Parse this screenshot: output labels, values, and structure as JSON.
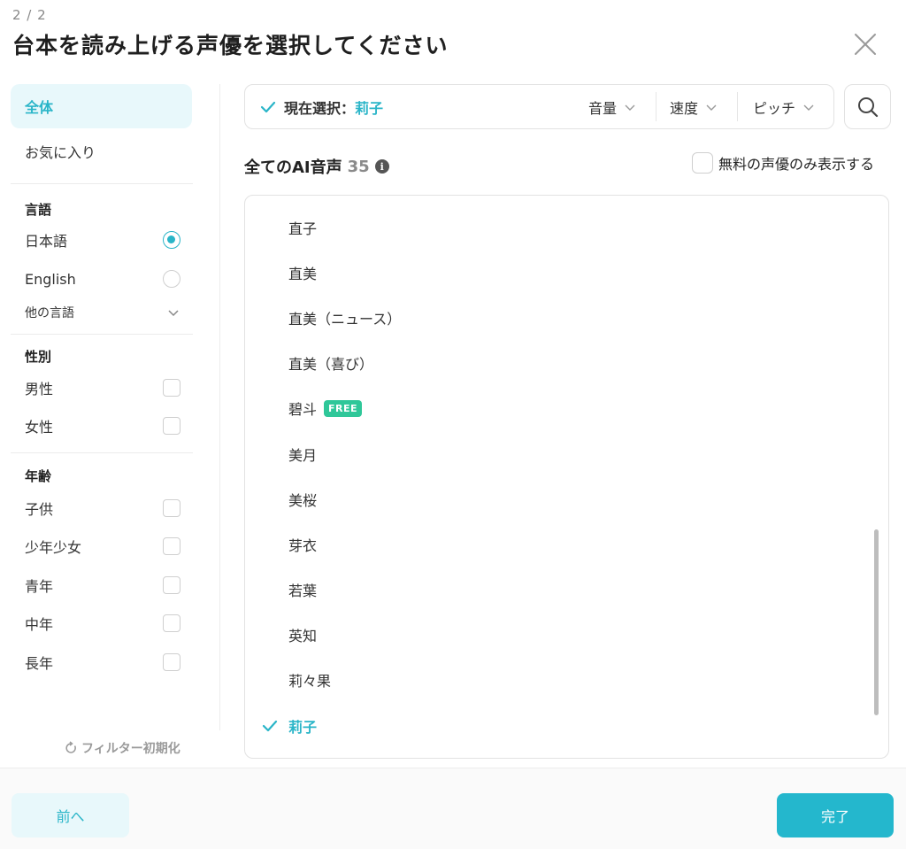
{
  "header": {
    "step": "2 / 2",
    "title": "台本を読み上げる声優を選択してください"
  },
  "sidebar": {
    "nav": [
      {
        "label": "全体",
        "active": true
      },
      {
        "label": "お気に入り",
        "active": false
      }
    ],
    "language": {
      "heading": "言語",
      "options": [
        {
          "label": "日本語",
          "selected": true
        },
        {
          "label": "English",
          "selected": false
        }
      ],
      "more_label": "他の言語"
    },
    "gender": {
      "heading": "性別",
      "options": [
        "男性",
        "女性"
      ]
    },
    "age": {
      "heading": "年齢",
      "options": [
        "子供",
        "少年少女",
        "青年",
        "中年",
        "長年"
      ]
    },
    "reset_label": "フィルター初期化"
  },
  "selection_bar": {
    "label": "現在選択：",
    "value": "莉子",
    "dropdowns": [
      "音量",
      "速度",
      "ピッチ"
    ]
  },
  "list": {
    "heading": "全てのAI音声",
    "count": "35",
    "free_filter_label": "無料の声優のみ表示する",
    "voices": [
      {
        "name": "直子",
        "free": false,
        "selected": false
      },
      {
        "name": "直美",
        "free": false,
        "selected": false
      },
      {
        "name": "直美（ニュース）",
        "free": false,
        "selected": false
      },
      {
        "name": "直美（喜び）",
        "free": false,
        "selected": false
      },
      {
        "name": "碧斗",
        "free": true,
        "selected": false
      },
      {
        "name": "美月",
        "free": false,
        "selected": false
      },
      {
        "name": "美桜",
        "free": false,
        "selected": false
      },
      {
        "name": "芽衣",
        "free": false,
        "selected": false
      },
      {
        "name": "若葉",
        "free": false,
        "selected": false
      },
      {
        "name": "英知",
        "free": false,
        "selected": false
      },
      {
        "name": "莉々果",
        "free": false,
        "selected": false
      },
      {
        "name": "莉子",
        "free": false,
        "selected": true
      }
    ],
    "free_badge": "FREE"
  },
  "footer": {
    "prev_label": "前へ",
    "done_label": "完了"
  },
  "colors": {
    "accent": "#2ab5c8",
    "free_badge": "#2fc799",
    "primary_button": "#24b7cd"
  },
  "icons": [
    "close-icon",
    "check-icon",
    "chevron-down-icon",
    "search-icon",
    "info-icon",
    "reset-icon"
  ]
}
